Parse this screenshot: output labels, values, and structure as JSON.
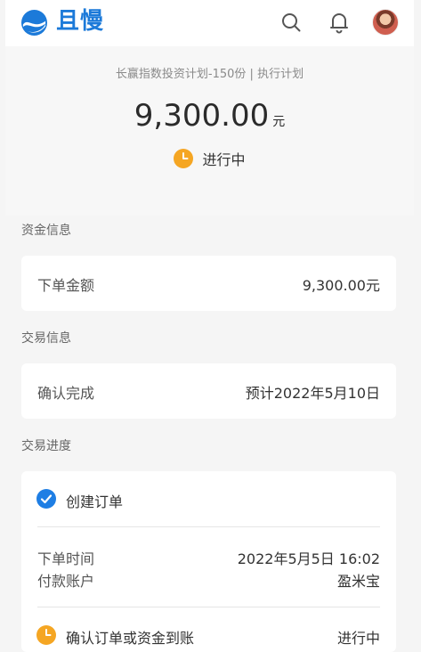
{
  "header": {
    "brand": "且慢",
    "search_icon": "search-icon",
    "bell_icon": "bell-icon"
  },
  "summary": {
    "plan_title": "长赢指数投资计划-150份 | 执行计划",
    "amount": "9,300.00",
    "amount_unit": "元",
    "status": "进行中",
    "status_color": "#f5a623"
  },
  "fund_section": {
    "label": "资金信息",
    "order_amount_label": "下单金额",
    "order_amount_value": "9,300.00元"
  },
  "trade_section": {
    "label": "交易信息",
    "confirm_label": "确认完成",
    "confirm_value": "预计2022年5月10日"
  },
  "progress_section": {
    "label": "交易进度",
    "step1_title": "创建订单",
    "order_time_label": "下单时间",
    "order_time_value": "2022年5月5日 16:02",
    "pay_account_label": "付款账户",
    "pay_account_value": "盈米宝",
    "step2_title": "确认订单或资金到账",
    "step2_status": "进行中"
  },
  "colors": {
    "brand_blue": "#1c7ad9",
    "check_blue": "#1e7ee4",
    "pending_orange": "#f5a623"
  }
}
